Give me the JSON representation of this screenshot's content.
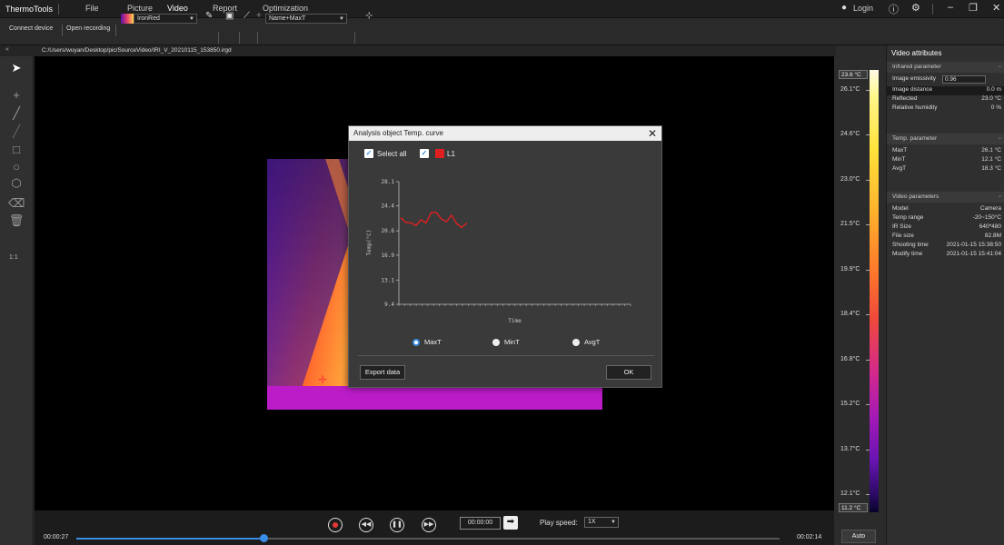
{
  "app": {
    "name": "ThermoTools",
    "menu": [
      "File",
      "Picture",
      "Video",
      "Report",
      "Optimization"
    ],
    "active_menu": "Video",
    "login": "Login"
  },
  "toolbar": {
    "connect_device": "Connect device",
    "open_recording": "Open recording",
    "palette": "IronRed",
    "label_mode": "Name+MaxT"
  },
  "file_path": "C:/Users/wuyan/Desktop/pic/SourceVideo/IRI_V_20210115_153850.irgd",
  "left_tools": {
    "ratio_label": "1:1"
  },
  "playback": {
    "current_time": "00:00:27",
    "total_time": "00:02:14",
    "goto_time": "00:00:00",
    "speed_label": "Play speed:",
    "speed_value": "1X",
    "progress": 0.266
  },
  "color_scale": {
    "max_box": "23.6 °C",
    "min_box": "11.2 °C",
    "labels": [
      "26.1°C",
      "24.6°C",
      "23.0°C",
      "21.5°C",
      "19.9°C",
      "18.4°C",
      "16.8°C",
      "15.2°C",
      "13.7°C",
      "12.1°C"
    ],
    "auto_button": "Auto"
  },
  "right_panel": {
    "title": "Video attributes",
    "infrared": {
      "header": "Infrared parameter",
      "emissivity_label": "Image emissivity",
      "emissivity_value": "0.96",
      "rows": [
        {
          "k": "Image distance",
          "v": "0.0 m"
        },
        {
          "k": "Reflected",
          "v": "23.0 °C"
        },
        {
          "k": "Relative humidity",
          "v": "0 %"
        }
      ]
    },
    "temp": {
      "header": "Temp. parameter",
      "rows": [
        {
          "k": "MaxT",
          "v": "26.1 °C"
        },
        {
          "k": "MinT",
          "v": "12.1 °C"
        },
        {
          "k": "AvgT",
          "v": "18.3 °C"
        }
      ]
    },
    "video": {
      "header": "Video parameters",
      "rows": [
        {
          "k": "Model",
          "v": "Camera"
        },
        {
          "k": "Temp range",
          "v": "-20~150°C"
        },
        {
          "k": "IR Size",
          "v": "640*480"
        },
        {
          "k": "File size",
          "v": "82.8M"
        },
        {
          "k": "Shooting time",
          "v": "2021-01-15 15:38:50"
        },
        {
          "k": "Modify time",
          "v": "2021-01-15 15:41:04"
        }
      ]
    }
  },
  "dialog": {
    "title": "Analysis object Temp. curve",
    "select_all": "Select all",
    "series_name": "L1",
    "radios": [
      "MaxT",
      "MinT",
      "AvgT"
    ],
    "selected_radio": "MaxT",
    "export_button": "Export data",
    "ok_button": "OK"
  },
  "chart_data": {
    "type": "line",
    "xlabel": "Time",
    "ylabel": "Temp(°C)",
    "y_ticks": [
      "28.1",
      "24.4",
      "20.6",
      "16.9",
      "13.1",
      "9.4"
    ],
    "ylim": [
      9.4,
      28.1
    ],
    "series": [
      {
        "name": "L1",
        "color": "#e02020",
        "values": [
          22.6,
          21.9,
          21.8,
          21.4,
          22.3,
          21.8,
          23.4,
          23.4,
          22.4,
          22.0,
          23.0,
          21.7,
          21.1,
          21.8
        ]
      }
    ]
  }
}
